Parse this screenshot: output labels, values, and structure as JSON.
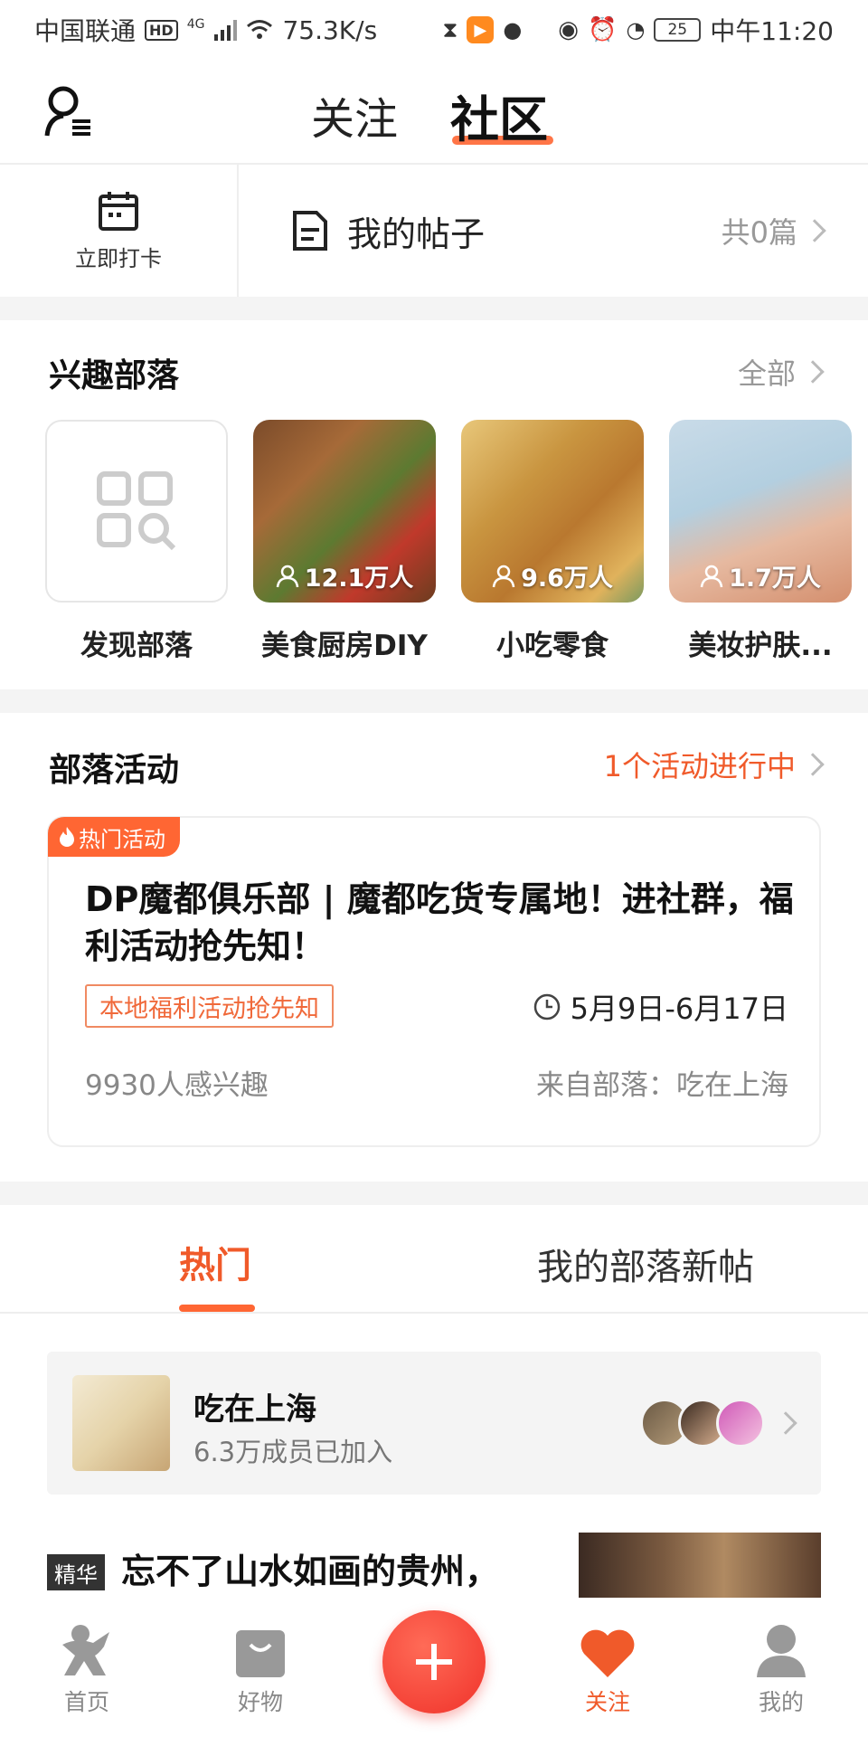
{
  "status_bar": {
    "carrier": "中国联通",
    "hd": "HD",
    "net": "4G",
    "speed": "75.3K/s",
    "battery": "25",
    "time": "中午11:20"
  },
  "header": {
    "tab_follow": "关注",
    "tab_community": "社区",
    "accent": "#ff6633"
  },
  "checkin": {
    "label": "立即打卡"
  },
  "my_posts": {
    "title": "我的帖子",
    "count": "共0篇"
  },
  "interest": {
    "title": "兴趣部落",
    "more": "全部",
    "tribes": [
      {
        "name": "发现部落",
        "members": ""
      },
      {
        "name": "美食厨房DIY",
        "members": "12.1万人"
      },
      {
        "name": "小吃零食",
        "members": "9.6万人"
      },
      {
        "name": "美妆护肤...",
        "members": "1.7万人"
      }
    ]
  },
  "activity": {
    "title": "部落活动",
    "status": "1个活动进行中",
    "card": {
      "badge": "热门活动",
      "title": "DP魔都俱乐部 | 魔都吃货专属地！进社群，福利活动抢先知！",
      "tag": "本地福利活动抢先知",
      "date": "5月9日-6月17日",
      "interest": "9930人感兴趣",
      "from": "来自部落：吃在上海"
    }
  },
  "feed_tabs": {
    "hot": "热门",
    "mine": "我的部落新帖"
  },
  "tribe_banner": {
    "name": "吃在上海",
    "members": "6.3万成员已加入"
  },
  "featured_post": {
    "badge": "精华",
    "title": "忘不了山水如画的贵州，"
  },
  "bottom_nav": [
    {
      "label": "首页",
      "icon": "home-icon"
    },
    {
      "label": "好物",
      "icon": "bag-icon"
    },
    {
      "label": "",
      "icon": "plus-icon"
    },
    {
      "label": "关注",
      "icon": "heart-icon",
      "active": true
    },
    {
      "label": "我的",
      "icon": "user-icon"
    }
  ]
}
